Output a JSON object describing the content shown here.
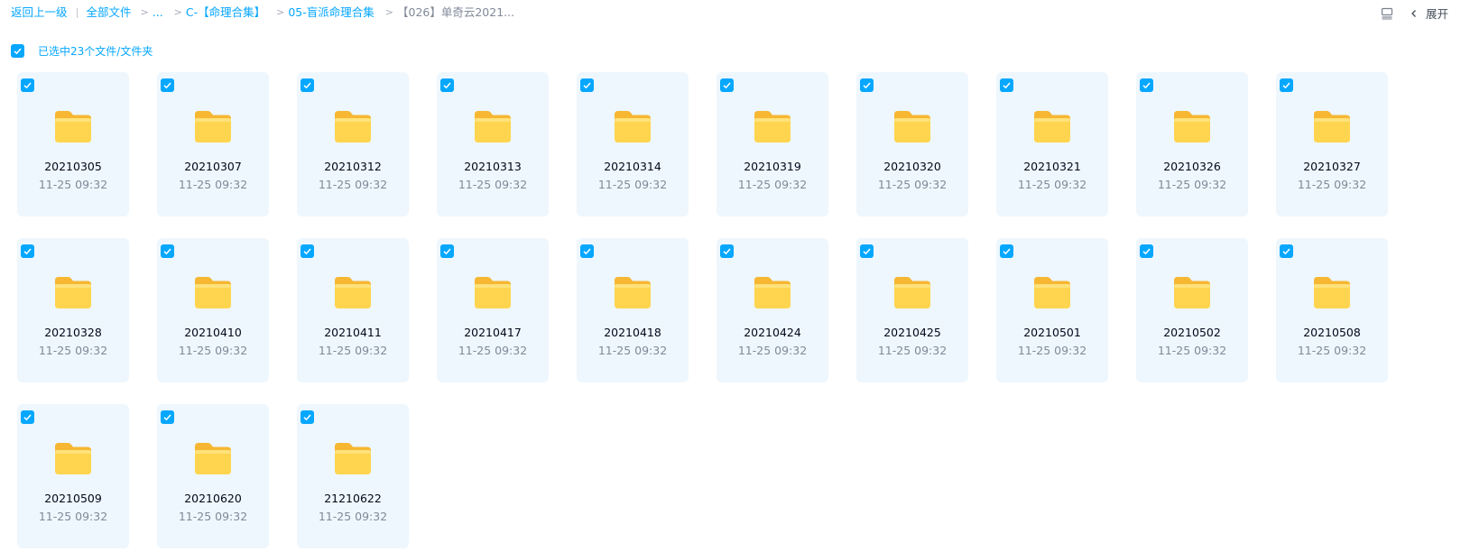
{
  "breadcrumb": {
    "back_label": "返回上一级",
    "root_label": "全部文件",
    "ellipsis": "...",
    "sep": ">",
    "level1": "C-【命理合集】",
    "level2": "05-盲派命理合集",
    "current": "【026】单奇云2021..."
  },
  "toolbar": {
    "view_icon": "list-view-icon",
    "expand_label": "展开"
  },
  "selection": {
    "label": "已选中23个文件/文件夹",
    "checked": true
  },
  "colors": {
    "accent": "#06a7ff",
    "card_bg": "#eef7fd",
    "folder_yellow": "#ffd54f",
    "muted_text": "#818999"
  },
  "files": [
    {
      "name": "20210305",
      "time": "11-25 09:32",
      "checked": true
    },
    {
      "name": "20210307",
      "time": "11-25 09:32",
      "checked": true
    },
    {
      "name": "20210312",
      "time": "11-25 09:32",
      "checked": true
    },
    {
      "name": "20210313",
      "time": "11-25 09:32",
      "checked": true
    },
    {
      "name": "20210314",
      "time": "11-25 09:32",
      "checked": true
    },
    {
      "name": "20210319",
      "time": "11-25 09:32",
      "checked": true
    },
    {
      "name": "20210320",
      "time": "11-25 09:32",
      "checked": true
    },
    {
      "name": "20210321",
      "time": "11-25 09:32",
      "checked": true
    },
    {
      "name": "20210326",
      "time": "11-25 09:32",
      "checked": true
    },
    {
      "name": "20210327",
      "time": "11-25 09:32",
      "checked": true
    },
    {
      "name": "20210328",
      "time": "11-25 09:32",
      "checked": true
    },
    {
      "name": "20210410",
      "time": "11-25 09:32",
      "checked": true
    },
    {
      "name": "20210411",
      "time": "11-25 09:32",
      "checked": true
    },
    {
      "name": "20210417",
      "time": "11-25 09:32",
      "checked": true
    },
    {
      "name": "20210418",
      "time": "11-25 09:32",
      "checked": true
    },
    {
      "name": "20210424",
      "time": "11-25 09:32",
      "checked": true
    },
    {
      "name": "20210425",
      "time": "11-25 09:32",
      "checked": true
    },
    {
      "name": "20210501",
      "time": "11-25 09:32",
      "checked": true
    },
    {
      "name": "20210502",
      "time": "11-25 09:32",
      "checked": true
    },
    {
      "name": "20210508",
      "time": "11-25 09:32",
      "checked": true
    },
    {
      "name": "20210509",
      "time": "11-25 09:32",
      "checked": true
    },
    {
      "name": "20210620",
      "time": "11-25 09:32",
      "checked": true
    },
    {
      "name": "21210622",
      "time": "11-25 09:32",
      "checked": true
    }
  ]
}
